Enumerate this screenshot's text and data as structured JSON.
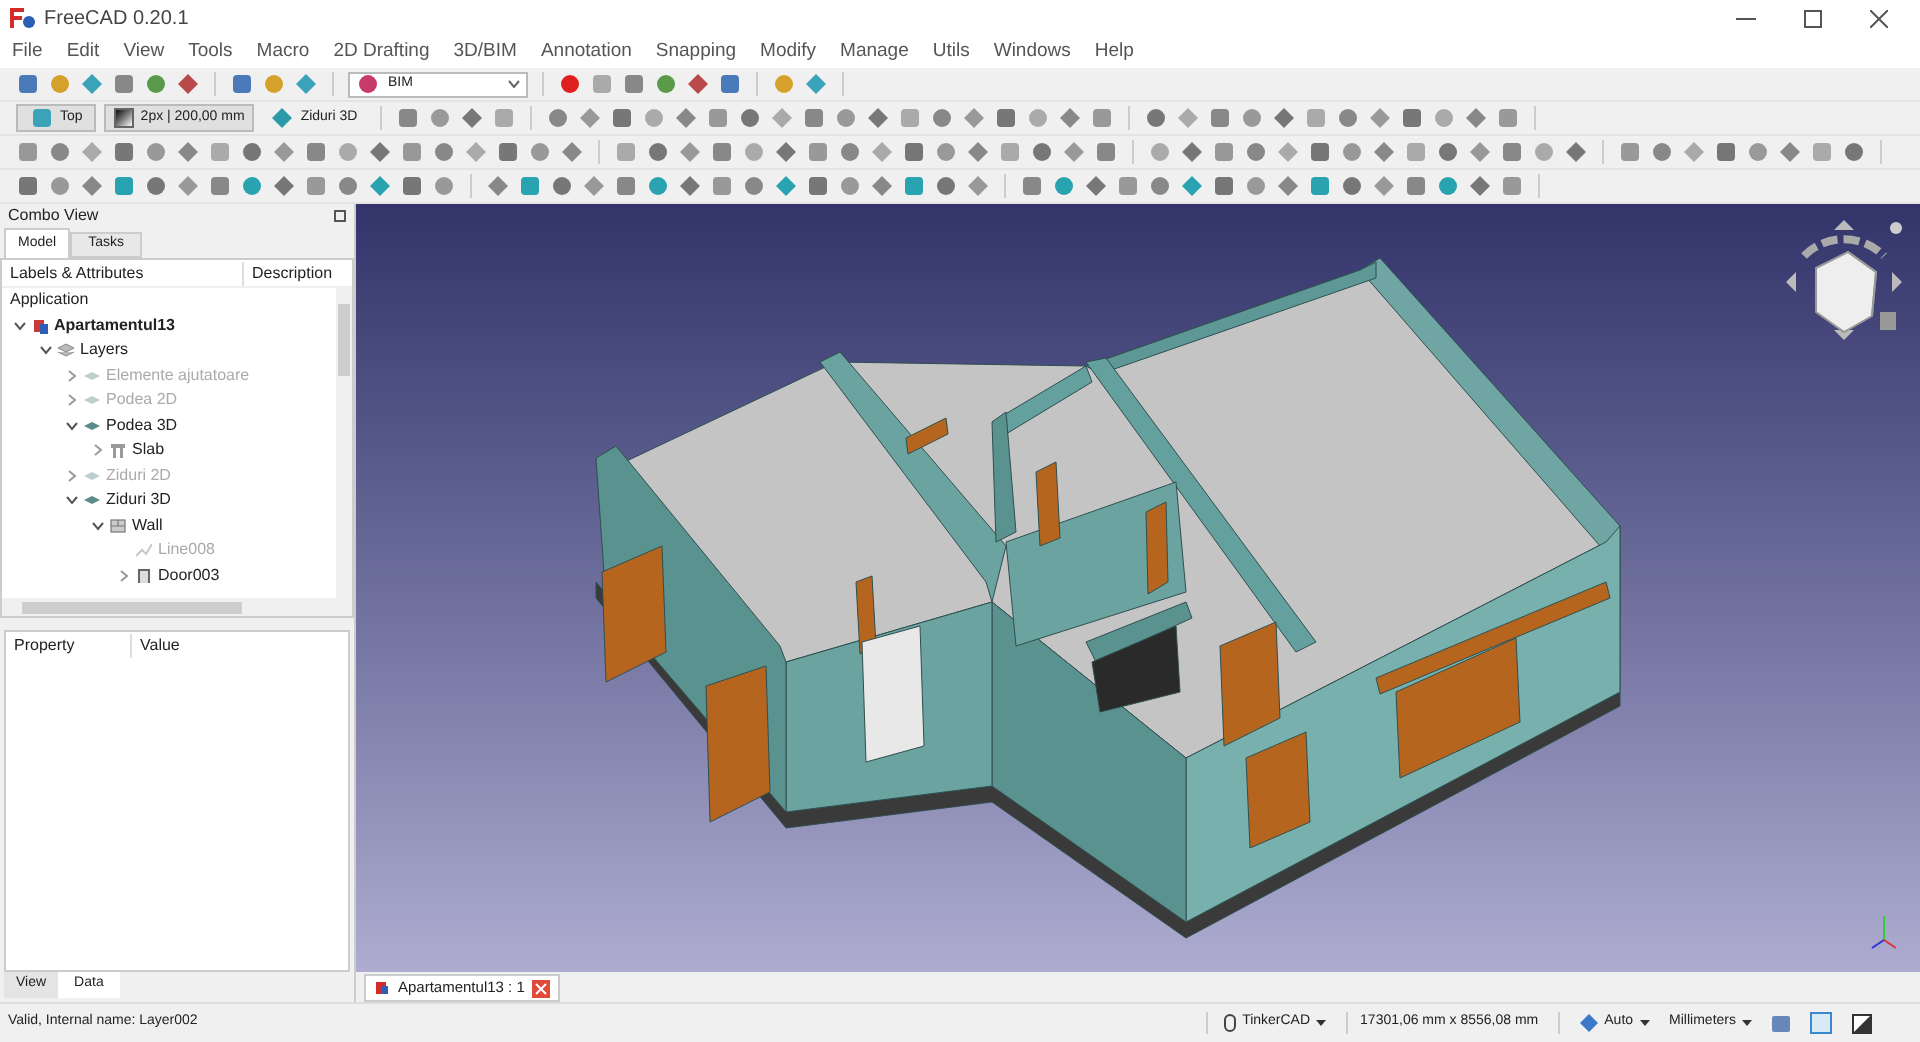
{
  "window": {
    "title": "FreeCAD 0.20.1"
  },
  "menu": [
    "File",
    "Edit",
    "View",
    "Tools",
    "Macro",
    "2D Drafting",
    "3D/BIM",
    "Annotation",
    "Snapping",
    "Modify",
    "Manage",
    "Utils",
    "Windows",
    "Help"
  ],
  "toolbar": {
    "workbench": "BIM",
    "view_button": "Top",
    "line_style": "2px | 200,00 mm",
    "layer_button": "Ziduri 3D"
  },
  "combo_view": {
    "title": "Combo View",
    "tabs": [
      {
        "label": "Model",
        "selected": true
      },
      {
        "label": "Tasks",
        "selected": false
      }
    ],
    "columns": [
      "Labels & Attributes",
      "Description"
    ],
    "root_label": "Application",
    "tree": [
      {
        "label": "Apartamentul13",
        "kind": "document",
        "expanded": true,
        "visible": true,
        "children": [
          {
            "label": "Layers",
            "kind": "group",
            "expanded": true,
            "visible": true,
            "children": [
              {
                "label": "Elemente ajutatoare",
                "kind": "layer",
                "expanded": false,
                "visible": false
              },
              {
                "label": "Podea 2D",
                "kind": "layer",
                "expanded": false,
                "visible": false
              },
              {
                "label": "Podea 3D",
                "kind": "layer",
                "expanded": true,
                "visible": true,
                "children": [
                  {
                    "label": "Slab",
                    "kind": "slab",
                    "expanded": false,
                    "visible": true
                  }
                ]
              },
              {
                "label": "Ziduri 2D",
                "kind": "layer",
                "expanded": false,
                "visible": false
              },
              {
                "label": "Ziduri 3D",
                "kind": "layer",
                "expanded": true,
                "visible": true,
                "children": [
                  {
                    "label": "Wall",
                    "kind": "wall",
                    "expanded": true,
                    "visible": true,
                    "children": [
                      {
                        "label": "Line008",
                        "kind": "line",
                        "visible": false
                      },
                      {
                        "label": "Door003",
                        "kind": "door",
                        "expanded": false,
                        "visible": true
                      }
                    ]
                  }
                ]
              }
            ]
          }
        ]
      }
    ],
    "property_columns": [
      "Property",
      "Value"
    ],
    "bottom_tabs": [
      {
        "label": "View",
        "selected": true
      },
      {
        "label": "Data",
        "selected": false
      }
    ]
  },
  "document_tab": "Apartamentul13 : 1",
  "status_bar": {
    "message": "Valid, Internal name: Layer002",
    "navigation": "TinkerCAD",
    "dimensions": "17301,06 mm x 8556,08 mm",
    "mode": "Auto",
    "units": "Millimeters"
  }
}
